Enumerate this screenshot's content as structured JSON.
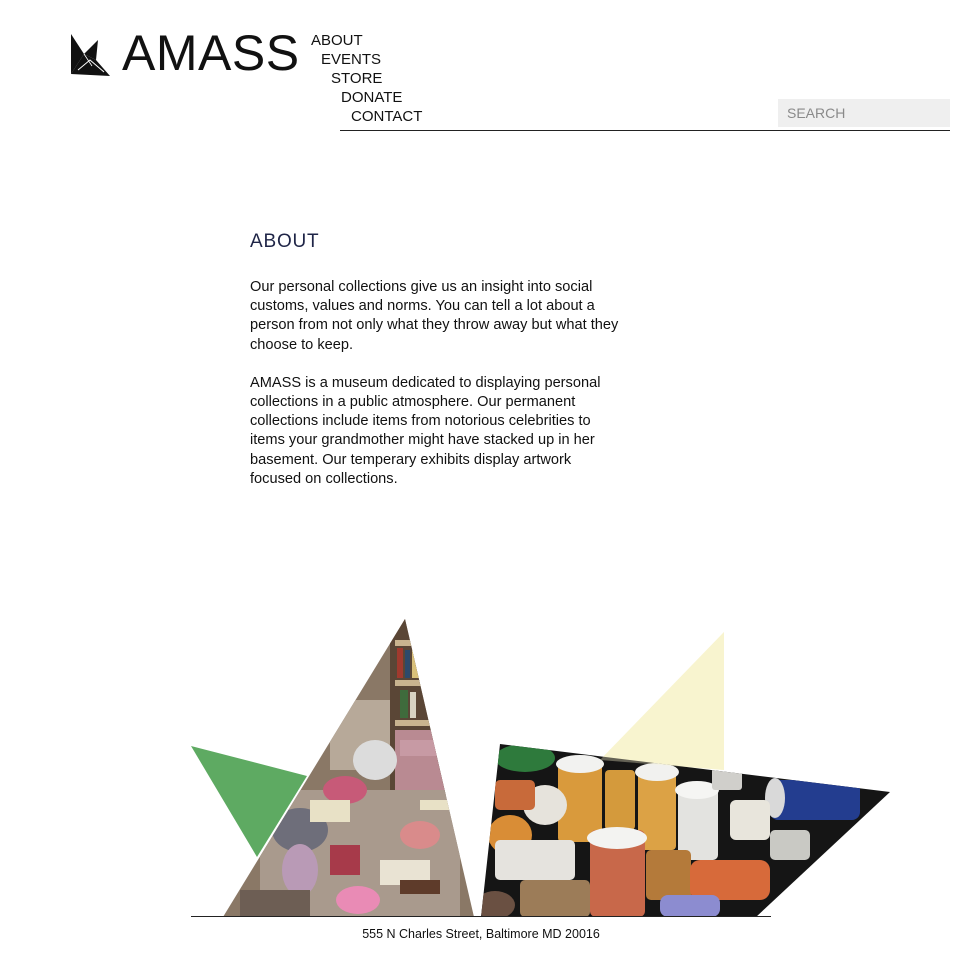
{
  "brand": {
    "name": "AMASS"
  },
  "nav": {
    "items": [
      "ABOUT",
      "EVENTS",
      "STORE",
      "DONATE",
      "CONTACT"
    ]
  },
  "search": {
    "placeholder": "SEARCH",
    "value": ""
  },
  "about": {
    "title": "ABOUT",
    "paragraphs": [
      "Our personal collections give us an insight into social customs, values and norms. You can tell a lot about a person from not only what they throw away but what they choose to keep.",
      "AMASS is a museum dedicated to displaying personal collections in a public atmosphere. Our permanent collections include items from notorious celebrities to items your grandmother might have stacked up in her basement. Our temperary exhibits display artwork focused on collections."
    ]
  },
  "footer": {
    "address": "555 N Charles Street, Baltimore MD 20016"
  },
  "colors": {
    "title": "#1f2547",
    "green_triangle": "#5eaa62",
    "yellow_triangle": "#f8f4cf",
    "search_bg": "#efefef"
  }
}
